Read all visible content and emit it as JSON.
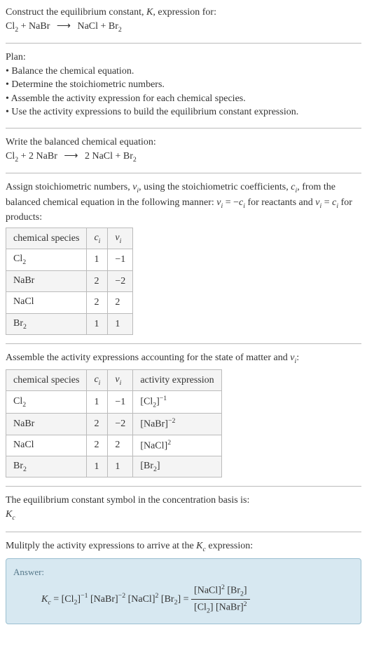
{
  "header": {
    "title_line1": "Construct the equilibrium constant, ",
    "title_K": "K",
    "title_line1b": ", expression for:",
    "eqn_left1": "Cl",
    "eqn_left1_sub": "2",
    "eqn_plus": " + NaBr ",
    "eqn_arrow": "⟶",
    "eqn_right": " NaCl + Br",
    "eqn_right_sub": "2"
  },
  "plan": {
    "heading": "Plan:",
    "b1": "• Balance the chemical equation.",
    "b2": "• Determine the stoichiometric numbers.",
    "b3": "• Assemble the activity expression for each chemical species.",
    "b4": "• Use the activity expressions to build the equilibrium constant expression."
  },
  "balanced": {
    "intro": "Write the balanced chemical equation:",
    "l1": "Cl",
    "l1sub": "2",
    "mid": " + 2 NaBr ",
    "arrow": "⟶",
    "r": " 2 NaCl + Br",
    "rsub": "2"
  },
  "stoich": {
    "intro1": "Assign stoichiometric numbers, ",
    "nu": "ν",
    "i": "i",
    "intro2": ", using the stoichiometric coefficients, ",
    "c": "c",
    "intro3": ", from the balanced chemical equation in the following manner: ",
    "eq1a": "ν",
    "eq1b": " = −",
    "eq1c": "c",
    "intro4": " for reactants and ",
    "eq2a": "ν",
    "eq2b": " = ",
    "eq2c": "c",
    "intro5": " for products:",
    "table": {
      "h1": "chemical species",
      "h2c": "c",
      "h2i": "i",
      "h3n": "ν",
      "h3i": "i",
      "r1": {
        "sp": "Cl",
        "sub": "2",
        "c": "1",
        "n": "−1"
      },
      "r2": {
        "sp": "NaBr",
        "sub": "",
        "c": "2",
        "n": "−2"
      },
      "r3": {
        "sp": "NaCl",
        "sub": "",
        "c": "2",
        "n": "2"
      },
      "r4": {
        "sp": "Br",
        "sub": "2",
        "c": "1",
        "n": "1"
      }
    }
  },
  "activity": {
    "intro1": "Assemble the activity expressions accounting for the state of matter and ",
    "nu": "ν",
    "i": "i",
    "intro2": ":",
    "table": {
      "h1": "chemical species",
      "h2c": "c",
      "h2i": "i",
      "h3n": "ν",
      "h3i": "i",
      "h4": "activity expression",
      "r1": {
        "sp": "Cl",
        "sub": "2",
        "c": "1",
        "n": "−1",
        "ex": "[Cl",
        "exsub": "2",
        "exsup": "−1"
      },
      "r2": {
        "sp": "NaBr",
        "sub": "",
        "c": "2",
        "n": "−2",
        "ex": "[NaBr]",
        "exsub": "",
        "exsup": "−2"
      },
      "r3": {
        "sp": "NaCl",
        "sub": "",
        "c": "2",
        "n": "2",
        "ex": "[NaCl]",
        "exsub": "",
        "exsup": "2"
      },
      "r4": {
        "sp": "Br",
        "sub": "2",
        "c": "1",
        "n": "1",
        "ex": "[Br",
        "exsub": "2",
        "exsup": ""
      }
    }
  },
  "symbol": {
    "line": "The equilibrium constant symbol in the concentration basis is:",
    "K": "K",
    "c": "c"
  },
  "multiply": {
    "line1": "Mulitply the activity expressions to arrive at the ",
    "K": "K",
    "c": "c",
    "line2": " expression:"
  },
  "answer": {
    "label": "Answer:",
    "K": "K",
    "c": "c",
    "eq": " = [Cl",
    "t1sub": "2",
    "t1sup": "−1",
    "t2": " [NaBr]",
    "t2sup": "−2",
    "t3": " [NaCl]",
    "t3sup": "2",
    "t4": " [Br",
    "t4sub": "2",
    "eqmid": "] = ",
    "numA": "[NaCl]",
    "numAsup": "2",
    "numB": " [Br",
    "numBsub": "2",
    "numBend": "]",
    "denA": "[Cl",
    "denAsub": "2",
    "denAend": "]",
    "denB": " [NaBr]",
    "denBsup": "2"
  }
}
